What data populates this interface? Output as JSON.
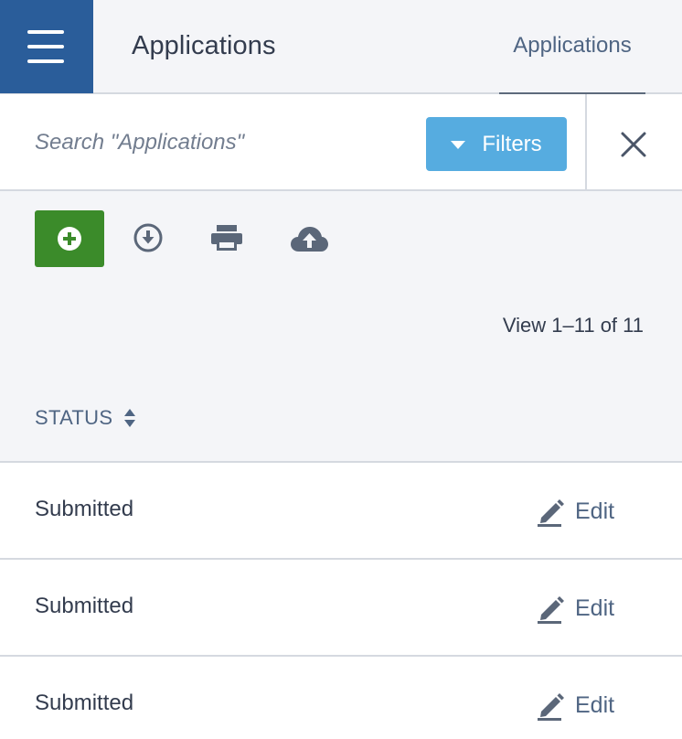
{
  "header": {
    "title": "Applications",
    "tab_label": "Applications"
  },
  "search": {
    "placeholder": "Search \"Applications\"",
    "value": "",
    "filters_label": "Filters"
  },
  "toolbar": {
    "icons": [
      "plus-circle-icon",
      "download-circle-icon",
      "print-icon",
      "cloud-upload-icon"
    ]
  },
  "pagination": {
    "text": "View 1–11 of 11"
  },
  "table": {
    "column_status": "STATUS",
    "rows": [
      {
        "status": "Submitted",
        "action": "Edit"
      },
      {
        "status": "Submitted",
        "action": "Edit"
      },
      {
        "status": "Submitted",
        "action": "Edit"
      }
    ]
  },
  "colors": {
    "primary_dark": "#2a5d9a",
    "filters_blue": "#56ace0",
    "add_green": "#3b8b2a",
    "text": "#333c4e",
    "muted": "#4f6583"
  }
}
